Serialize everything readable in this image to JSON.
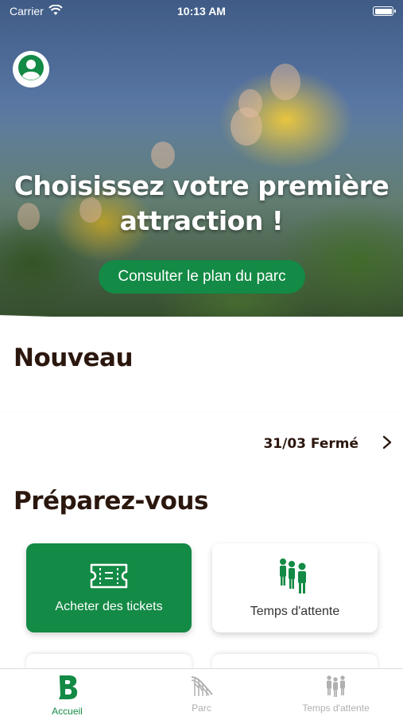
{
  "status_bar": {
    "carrier": "Carrier",
    "time": "10:13 AM"
  },
  "hero": {
    "title_line1": "Choisissez votre première",
    "title_line2": "attraction !",
    "cta_label": "Consulter le plan du parc"
  },
  "sections": {
    "nouveau_title": "Nouveau",
    "prep_title": "Préparez-vous"
  },
  "info_row": {
    "date_status": "31/03 Fermé"
  },
  "cards": [
    {
      "label": "Acheter des tickets",
      "icon": "ticket-icon"
    },
    {
      "label": "Temps d'attente",
      "icon": "queue-people-icon"
    }
  ],
  "tab_bar": {
    "tabs": [
      {
        "label": "Accueil",
        "icon": "park-logo-icon",
        "active": true
      },
      {
        "label": "Parc",
        "icon": "roller-coaster-icon",
        "active": false
      },
      {
        "label": "Temps d'attente",
        "icon": "queue-people-icon",
        "active": false
      }
    ]
  },
  "colors": {
    "brand_green": "#138a45",
    "title_brown": "#2b170e"
  }
}
